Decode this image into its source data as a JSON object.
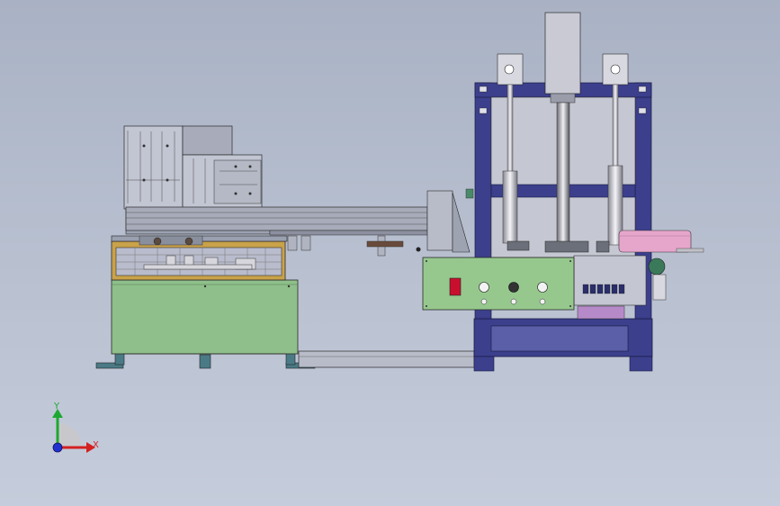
{
  "viewport": {
    "background_top": "#a9b2c4",
    "background_bottom": "#c5ccdb"
  },
  "machine": {
    "frame_color": "#3b3f8c",
    "panel_green": "#8fbf8a",
    "control_box_green": "#96c88e",
    "roller_pink": "#e6a6cc",
    "emergency_stop_red": "#c8102e"
  },
  "triad": {
    "x_label": "X",
    "y_label": "Y",
    "x_color": "#d42020",
    "y_color": "#1ea832",
    "z_color": "#2030d0"
  }
}
